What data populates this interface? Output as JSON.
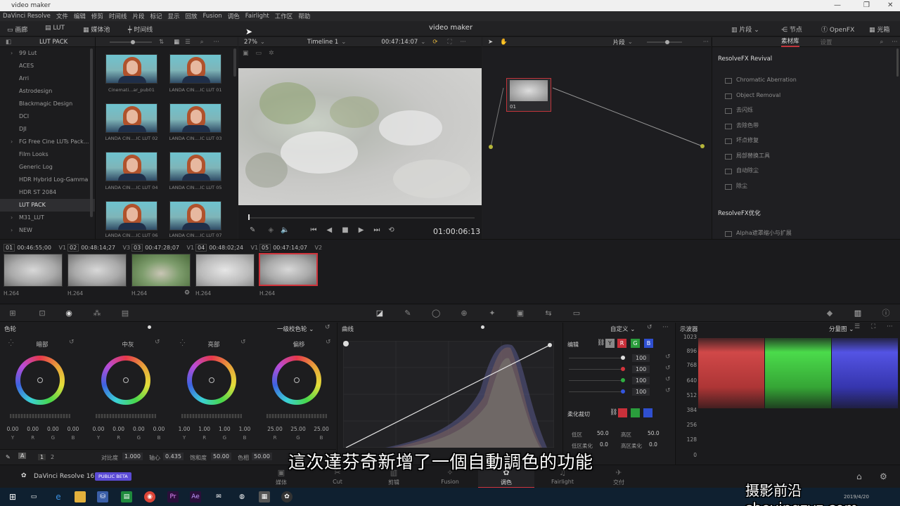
{
  "window": {
    "title": "video maker",
    "controls": [
      "—",
      "❐",
      "✕"
    ]
  },
  "menu": [
    "DaVinci Resolve",
    "文件",
    "编辑",
    "修剪",
    "时间线",
    "片段",
    "标记",
    "显示",
    "回放",
    "Fusion",
    "调色",
    "Fairlight",
    "工作区",
    "帮助"
  ],
  "toolbar": {
    "gallery": "画廊",
    "lut": "LUT",
    "media_pool": "媒体池",
    "timeline": "时间线",
    "project_title": "video maker",
    "clips": "片段",
    "nodes": "节点",
    "openfx": "OpenFX",
    "lightbox": "光箱"
  },
  "lut_panel": {
    "title": "LUT PACK",
    "items": [
      {
        "label": "99 Lut",
        "arrow": "›"
      },
      {
        "label": "ACES",
        "arrow": ""
      },
      {
        "label": "Arri",
        "arrow": ""
      },
      {
        "label": "Astrodesign",
        "arrow": ""
      },
      {
        "label": "Blackmagic Design",
        "arrow": ""
      },
      {
        "label": "DCI",
        "arrow": ""
      },
      {
        "label": "DJI",
        "arrow": ""
      },
      {
        "label": "FG Free Cine LUTs Pack...",
        "arrow": "›"
      },
      {
        "label": "Film Looks",
        "arrow": ""
      },
      {
        "label": "Generic Log",
        "arrow": ""
      },
      {
        "label": "HDR Hybrid Log-Gamma",
        "arrow": ""
      },
      {
        "label": "HDR ST 2084",
        "arrow": ""
      },
      {
        "label": "LUT PACK",
        "arrow": "",
        "active": true
      },
      {
        "label": "M31_LUT",
        "arrow": "›"
      },
      {
        "label": "NEW",
        "arrow": "›"
      }
    ]
  },
  "thumbs": [
    "Cinemati...ar_pub01",
    "LANDA CIN....IC LUT 01",
    "LANDA CIN....IC LUT 02",
    "LANDA CIN....IC LUT 03",
    "LANDA CIN....IC LUT 04",
    "LANDA CIN....IC LUT 05",
    "LANDA CIN....IC LUT 06",
    "LANDA CIN....IC LUT 07"
  ],
  "viewer": {
    "zoom": "27%",
    "timeline": "Timeline 1",
    "timecode": "00:47:14:07",
    "playhead": "01:00:06:13"
  },
  "node_editor": {
    "mode": "片段",
    "node_label": "01"
  },
  "library": {
    "tab_active": "素材库",
    "tab_other": "设置",
    "section1": "ResolveFX Revival",
    "items": [
      "Chromatic Aberration",
      "Object Removal",
      "去闪烁",
      "去除色带",
      "坏点修复",
      "局部替换工具",
      "自动除尘",
      "除尘"
    ],
    "section2": "ResolveFX优化",
    "item2": "Alpha遮罩缩小与扩展"
  },
  "clips": [
    {
      "num": "01",
      "tc": "00:46:55;00",
      "track": "V1",
      "codec": "H.264"
    },
    {
      "num": "02",
      "tc": "00:48:14;27",
      "track": "V3",
      "codec": "H.264"
    },
    {
      "num": "03",
      "tc": "00:47:28;07",
      "track": "V1",
      "codec": "H.264"
    },
    {
      "num": "04",
      "tc": "00:48:02;24",
      "track": "V1",
      "codec": "H.264"
    },
    {
      "num": "05",
      "tc": "00:47:14;07",
      "track": "V2",
      "codec": "H.264"
    }
  ],
  "wheels": {
    "title": "色轮",
    "mode": "一级校色轮",
    "blocks": [
      {
        "name": "暗部",
        "vals": [
          "0.00",
          "0.00",
          "0.00",
          "0.00"
        ],
        "lbls": [
          "Y",
          "R",
          "G",
          "B"
        ]
      },
      {
        "name": "中灰",
        "vals": [
          "0.00",
          "0.00",
          "0.00",
          "0.00"
        ],
        "lbls": [
          "Y",
          "R",
          "G",
          "B"
        ]
      },
      {
        "name": "亮部",
        "vals": [
          "1.00",
          "1.00",
          "1.00",
          "1.00"
        ],
        "lbls": [
          "Y",
          "R",
          "G",
          "B"
        ]
      },
      {
        "name": "偏移",
        "vals": [
          "25.00",
          "25.00",
          "25.00"
        ],
        "lbls": [
          "R",
          "G",
          "B"
        ]
      }
    ],
    "footer": {
      "contrast_lbl": "对比度",
      "contrast": "1.000",
      "pivot_lbl": "轴心",
      "pivot": "0.435",
      "sat_lbl": "饱和度",
      "sat": "50.00",
      "hue_lbl": "色相",
      "hue": "50.00",
      "pages": [
        "1",
        "2"
      ],
      "a": "A"
    }
  },
  "curves": {
    "title": "曲线",
    "mode": "自定义",
    "edit_lbl": "编辑",
    "channels": [
      "Y",
      "R",
      "G",
      "B"
    ],
    "intensity": [
      "100",
      "100",
      "100",
      "100"
    ],
    "soft_lbl": "柔化裁切",
    "low_lbl": "低区",
    "low": "50.0",
    "high_lbl": "高区",
    "high": "50.0",
    "lowsoft_lbl": "低区柔化",
    "lowsoft": "0.0",
    "highsoft_lbl": "高区柔化",
    "highsoft": "0.0"
  },
  "scopes": {
    "title": "示波器",
    "mode": "分量图",
    "ticks": [
      "1023",
      "896",
      "768",
      "640",
      "512",
      "384",
      "256",
      "128",
      "0"
    ]
  },
  "pages": [
    "媒体",
    "Cut",
    "剪辑",
    "Fusion",
    "调色",
    "Fairlight",
    "交付"
  ],
  "pages_active": "调色",
  "brand": {
    "name": "DaVinci Resolve 16",
    "badge": "PUBLIC BETA"
  },
  "subtitle": "這次達芬奇新增了一個自動調色的功能",
  "watermark": "摄影前沿 sheyingzyz.com",
  "taskbar": {
    "date": "2019/4/20"
  },
  "colors": {
    "accent_red": "#d0343c",
    "panel": "#1d1d1f"
  }
}
